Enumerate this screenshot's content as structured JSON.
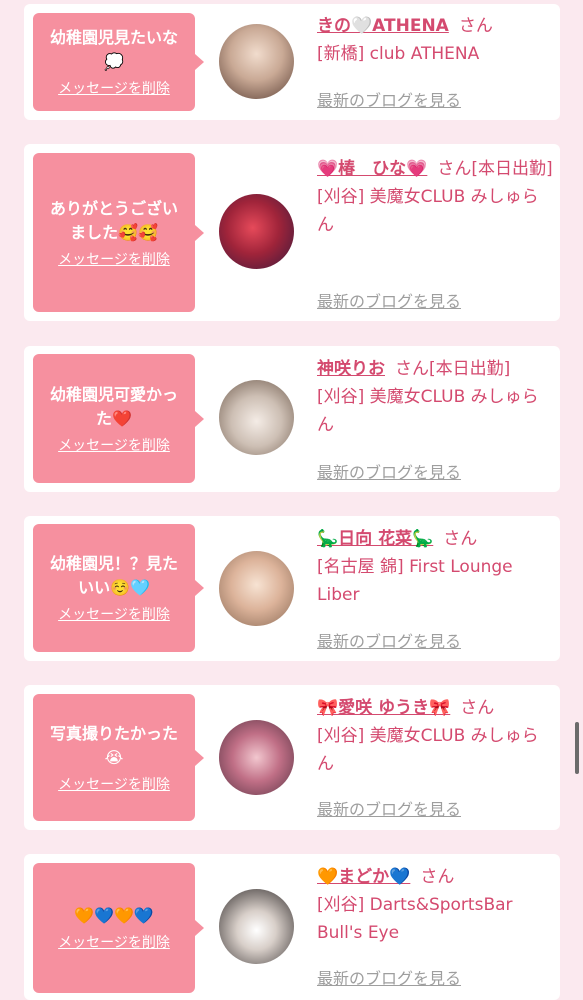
{
  "delete_label": "メッセージを削除",
  "blog_label": "最新のブログを見る",
  "san_label": "さん",
  "colors": {
    "bubble": "#f6909f",
    "accent": "#d44a6f",
    "page_bg": "#fbe9ef"
  },
  "cards": [
    {
      "message": "幼稚園児見たいな💭",
      "name": "きの🤍ATHENA",
      "status": "",
      "shop": "[新橋] club ATHENA"
    },
    {
      "message": "ありがとうございました🥰🥰",
      "name": "💗椿　ひな💗",
      "status": "[本日出勤]",
      "shop": "[刈谷] 美魔女CLUB みしゅらん"
    },
    {
      "message": "幼稚園児可愛かった❤️",
      "name": "神咲りお",
      "status": "[本日出勤]",
      "shop": "[刈谷] 美魔女CLUB みしゅらん"
    },
    {
      "message": "幼稚園児！？見たいい☺️🩵",
      "name": "🦕日向 花菜🦕",
      "status": "",
      "shop": "[名古屋 錦] First Lounge Liber"
    },
    {
      "message": "写真撮りたかった😭",
      "name": "🎀愛咲 ゆうき🎀",
      "status": "",
      "shop": "[刈谷] 美魔女CLUB みしゅらん"
    },
    {
      "message": "🧡💙🧡💙",
      "name": "🧡まどか💙",
      "status": "",
      "shop": "[刈谷] Darts&SportsBar Bull's Eye"
    }
  ]
}
